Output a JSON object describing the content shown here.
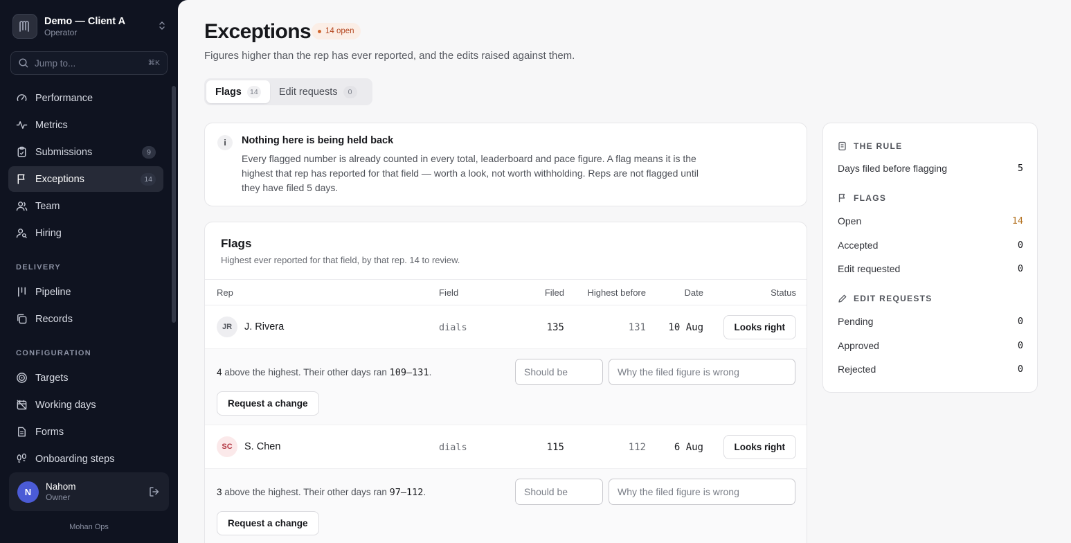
{
  "workspace": {
    "name": "Demo — Client A",
    "role": "Operator"
  },
  "search": {
    "placeholder": "Jump to...",
    "shortcut": "⌘K"
  },
  "nav": {
    "items": [
      {
        "label": "Performance",
        "icon": "gauge-icon"
      },
      {
        "label": "Metrics",
        "icon": "activity-icon"
      },
      {
        "label": "Submissions",
        "icon": "clipboard-icon",
        "count": "9"
      },
      {
        "label": "Exceptions",
        "icon": "flag-icon",
        "count": "14",
        "active": true
      },
      {
        "label": "Team",
        "icon": "users-icon"
      },
      {
        "label": "Hiring",
        "icon": "user-search-icon"
      }
    ],
    "delivery_label": "DELIVERY",
    "delivery": [
      {
        "label": "Pipeline",
        "icon": "kanban-icon"
      },
      {
        "label": "Records",
        "icon": "copy-icon"
      }
    ],
    "config_label": "CONFIGURATION",
    "config": [
      {
        "label": "Targets",
        "icon": "target-icon"
      },
      {
        "label": "Working days",
        "icon": "calendar-off-icon"
      },
      {
        "label": "Forms",
        "icon": "document-icon"
      },
      {
        "label": "Onboarding steps",
        "icon": "footprints-icon"
      }
    ]
  },
  "user": {
    "initial": "N",
    "name": "Nahom",
    "role": "Owner"
  },
  "brand_footer": "Mohan Ops",
  "page": {
    "title": "Exceptions",
    "badge": "14 open",
    "subtitle": "Figures higher than the rep has ever reported, and the edits raised against them."
  },
  "tabs": [
    {
      "label": "Flags",
      "count": "14",
      "active": true
    },
    {
      "label": "Edit requests",
      "count": "0"
    }
  ],
  "info": {
    "icon": "i",
    "title": "Nothing here is being held back",
    "body": "Every flagged number is already counted in every total, leaderboard and pace figure. A flag means it is the highest that rep has reported for that field — worth a look, not worth withholding. Reps are not flagged until they have filed 5 days."
  },
  "flags": {
    "title": "Flags",
    "subtitle": "Highest ever reported for that field, by that rep. 14 to review.",
    "columns": {
      "rep": "Rep",
      "field": "Field",
      "filed": "Filed",
      "highest": "Highest before",
      "date": "Date",
      "status": "Status"
    },
    "rows": [
      {
        "initials": "JR",
        "name": "J. Rivera",
        "field": "dials",
        "filed": "135",
        "highest": "131",
        "date": "10 Aug",
        "status_button": "Looks right",
        "detail_amount": "4",
        "detail_mid": " above the highest. Their other days ran ",
        "detail_range": "109–131",
        "detail_end": ".",
        "should_placeholder": "Should be",
        "why_placeholder": "Why the filed figure is wrong",
        "request_button": "Request a change"
      },
      {
        "initials": "SC",
        "name": "S. Chen",
        "field": "dials",
        "filed": "115",
        "highest": "112",
        "date": "6 Aug",
        "status_button": "Looks right",
        "detail_amount": "3",
        "detail_mid": " above the highest. Their other days ran ",
        "detail_range": "97–112",
        "detail_end": ".",
        "should_placeholder": "Should be",
        "why_placeholder": "Why the filed figure is wrong",
        "request_button": "Request a change"
      }
    ]
  },
  "side": {
    "rule_label": "THE RULE",
    "rule_rows": [
      {
        "label": "Days filed before flagging",
        "value": "5"
      }
    ],
    "flags_label": "FLAGS",
    "flags_rows": [
      {
        "label": "Open",
        "value": "14"
      },
      {
        "label": "Accepted",
        "value": "0"
      },
      {
        "label": "Edit requested",
        "value": "0"
      }
    ],
    "edits_label": "EDIT REQUESTS",
    "edits_rows": [
      {
        "label": "Pending",
        "value": "0"
      },
      {
        "label": "Approved",
        "value": "0"
      },
      {
        "label": "Rejected",
        "value": "0"
      }
    ]
  },
  "colors": {
    "accent_warn": "#b7782a",
    "badge_text": "#b4461f",
    "avatar_bg": "#4b5bd6",
    "sidebar_bg": "#0f1320"
  }
}
